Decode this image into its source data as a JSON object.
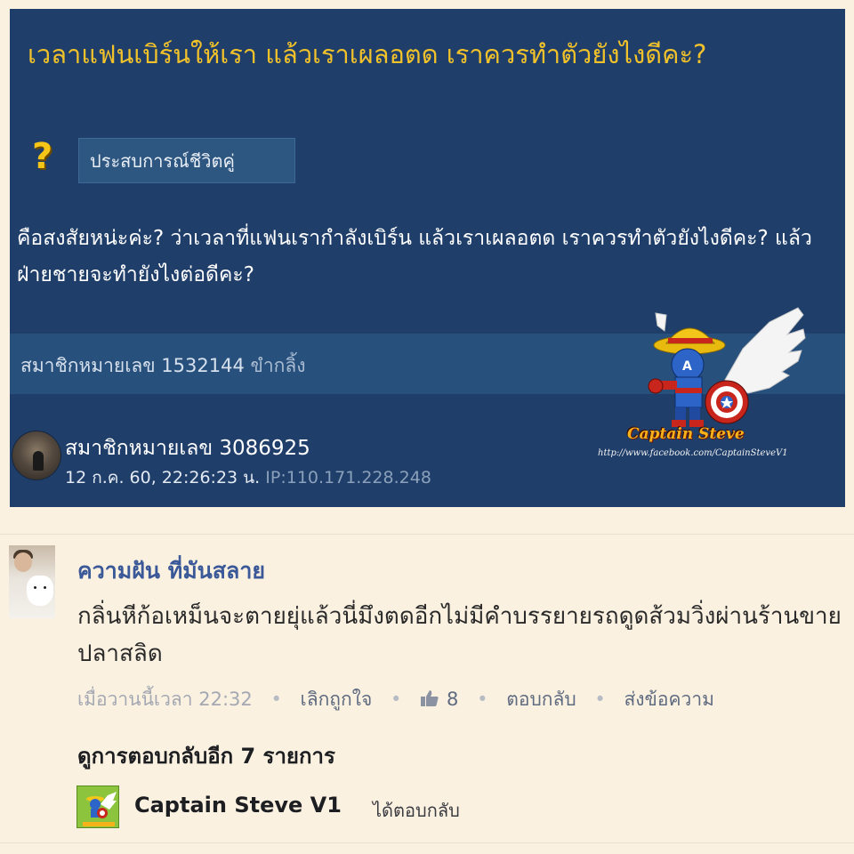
{
  "post": {
    "title": "เวลาแฟนเบิร์นให้เรา แล้วเราเผลอตด เราควรทำตัวยังไงดีคะ?",
    "question_icon": "?",
    "tag": "ประสบการณ์ชีวิตคู่",
    "body": "คือสงสัยหน่ะค่ะ? ว่าเวลาที่แฟนเรากำลังเบิร์น แล้วเราเผลอตด เราควรทำตัวยังไงดีคะ? แล้วฝ่ายชายจะทำยังไงต่อดีคะ?",
    "member_band": {
      "label": "สมาชิกหมายเลข 1532144",
      "alias": "ขำกลิ้ง"
    },
    "poster": {
      "name": "สมาชิกหมายเลข 3086925",
      "datetime": "12 ก.ค. 60, 22:26:23 น.",
      "ip": "IP:110.171.228.248"
    },
    "watermark": {
      "title": "Captain Steve",
      "url": "http://www.facebook.com/CaptainSteveV1"
    }
  },
  "comment": {
    "author": "ความฝัน ที่มันสลาย",
    "text": "กลิ่นหีก้อเหม็นจะตายยุ่แล้วนี่มึงตดอีกไม่มีคำบรรยายรถดูดส้วมวิ่งผ่านร้านขายปลาสลิด",
    "time": "เมื่อวานนี้เวลา 22:32",
    "unlike_label": "เลิกถูกใจ",
    "like_count": "8",
    "reply_label": "ตอบกลับ",
    "message_label": "ส่งข้อความ",
    "separator": "•",
    "more_replies": "ดูการตอบกลับอีก 7 รายการ",
    "reply": {
      "name": "Captain Steve V1",
      "suffix": "ได้ตอบกลับ"
    }
  },
  "colors": {
    "card_bg": "#1f3e6a",
    "title_yellow": "#f2c22a",
    "page_bg": "#fbf1e1",
    "fb_blue": "#3b5998"
  }
}
